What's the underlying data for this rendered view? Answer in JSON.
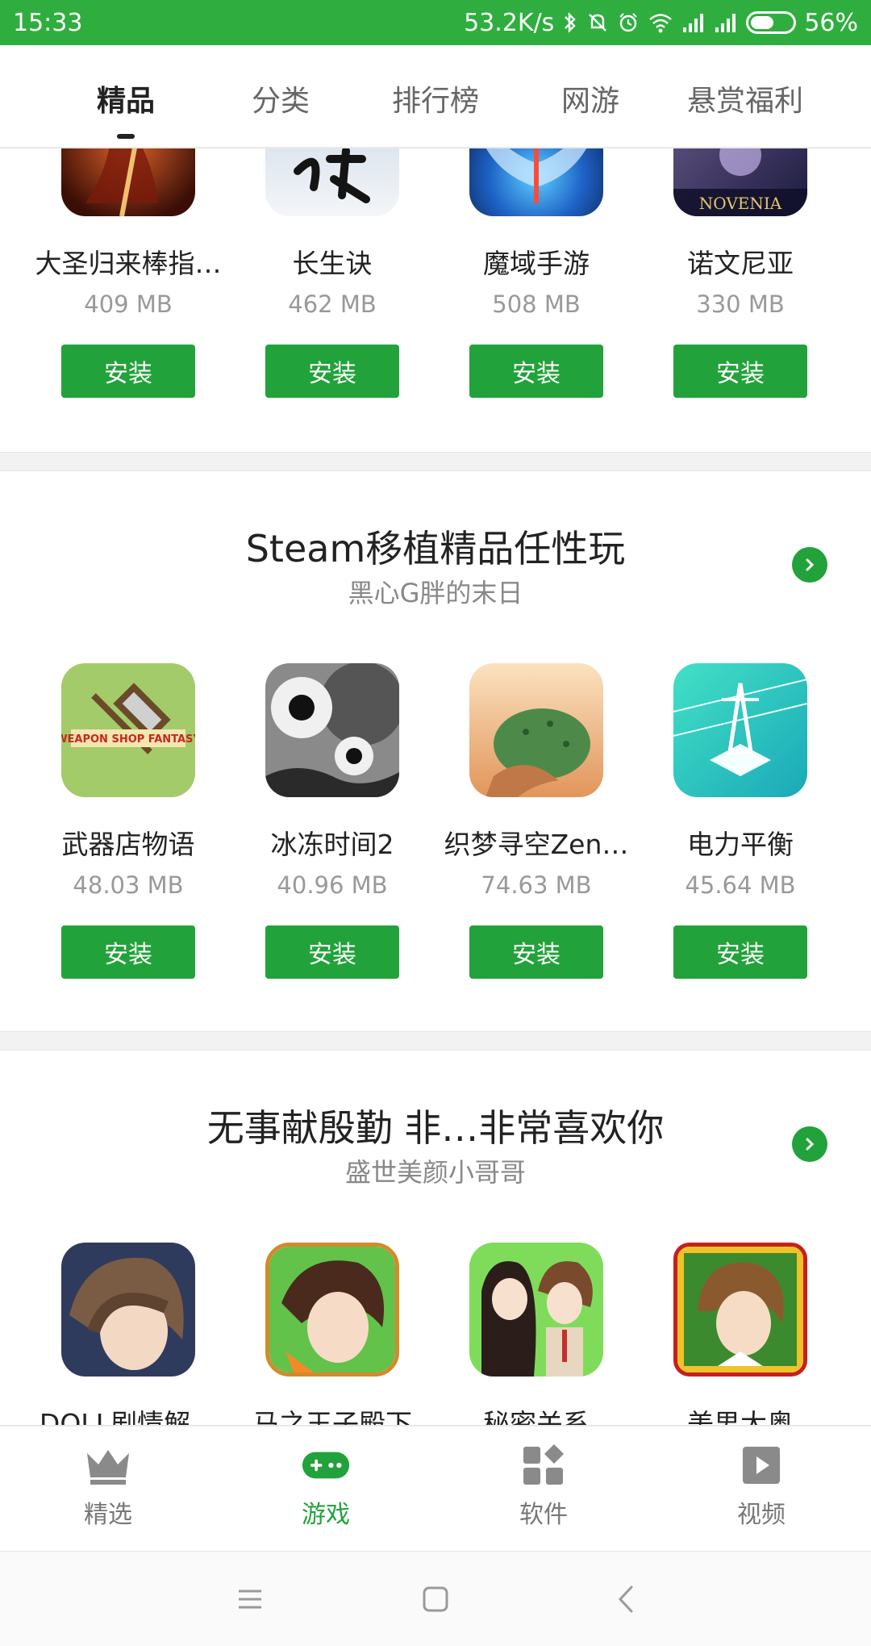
{
  "status_bar": {
    "time": "15:33",
    "speed": "53.2K/s",
    "battery": "56%",
    "battery_level": 0.56
  },
  "top_tabs": [
    {
      "label": "精品",
      "active": true
    },
    {
      "label": "分类",
      "active": false
    },
    {
      "label": "排行榜",
      "active": false
    },
    {
      "label": "网游",
      "active": false
    },
    {
      "label": "悬赏福利",
      "active": false
    }
  ],
  "section1": {
    "apps": [
      {
        "name": "大圣归来棒指…",
        "size": "409 MB",
        "button": "安装",
        "icon": "monkey-king-icon"
      },
      {
        "name": "长生诀",
        "size": "462 MB",
        "button": "安装",
        "icon": "calligraphy-icon"
      },
      {
        "name": "魔域手游",
        "size": "508 MB",
        "button": "安装",
        "icon": "wings-icon"
      },
      {
        "name": "诺文尼亚",
        "size": "330 MB",
        "button": "安装",
        "icon": "novenia-icon",
        "icon_text": "NOVENIA"
      }
    ]
  },
  "section2": {
    "title": "Steam移植精品任性玩",
    "subtitle": "黑心G胖的末日",
    "apps": [
      {
        "name": "武器店物语",
        "size": "48.03 MB",
        "button": "安装",
        "icon": "weapon-shop-icon",
        "icon_text": "WEAPON SHOP FANTASY"
      },
      {
        "name": "冰冻时间2",
        "size": "40.96 MB",
        "button": "安装",
        "icon": "eyes-gear-icon"
      },
      {
        "name": "织梦寻空Zen…",
        "size": "74.63 MB",
        "button": "安装",
        "icon": "cactus-hill-icon"
      },
      {
        "name": "电力平衡",
        "size": "45.64 MB",
        "button": "安装",
        "icon": "power-tower-icon"
      }
    ]
  },
  "section3": {
    "title": "无事献殷勤 非…非常喜欢你",
    "subtitle": "盛世美颜小哥哥",
    "apps": [
      {
        "name": "DOLL剧情解…",
        "icon": "doll-boy-icon"
      },
      {
        "name": "马之王子殿下",
        "icon": "horse-prince-icon"
      },
      {
        "name": "秘密关系",
        "icon": "secret-couple-icon"
      },
      {
        "name": "美男大奥",
        "icon": "handsome-man-icon"
      }
    ]
  },
  "bottom_nav": [
    {
      "label": "精选",
      "icon": "crown-icon",
      "active": false
    },
    {
      "label": "游戏",
      "icon": "gamepad-icon",
      "active": true
    },
    {
      "label": "软件",
      "icon": "apps-grid-icon",
      "active": false
    },
    {
      "label": "视频",
      "icon": "play-icon",
      "active": false
    }
  ],
  "colors": {
    "accent": "#22a23a",
    "status_bar": "#2fae3f"
  }
}
